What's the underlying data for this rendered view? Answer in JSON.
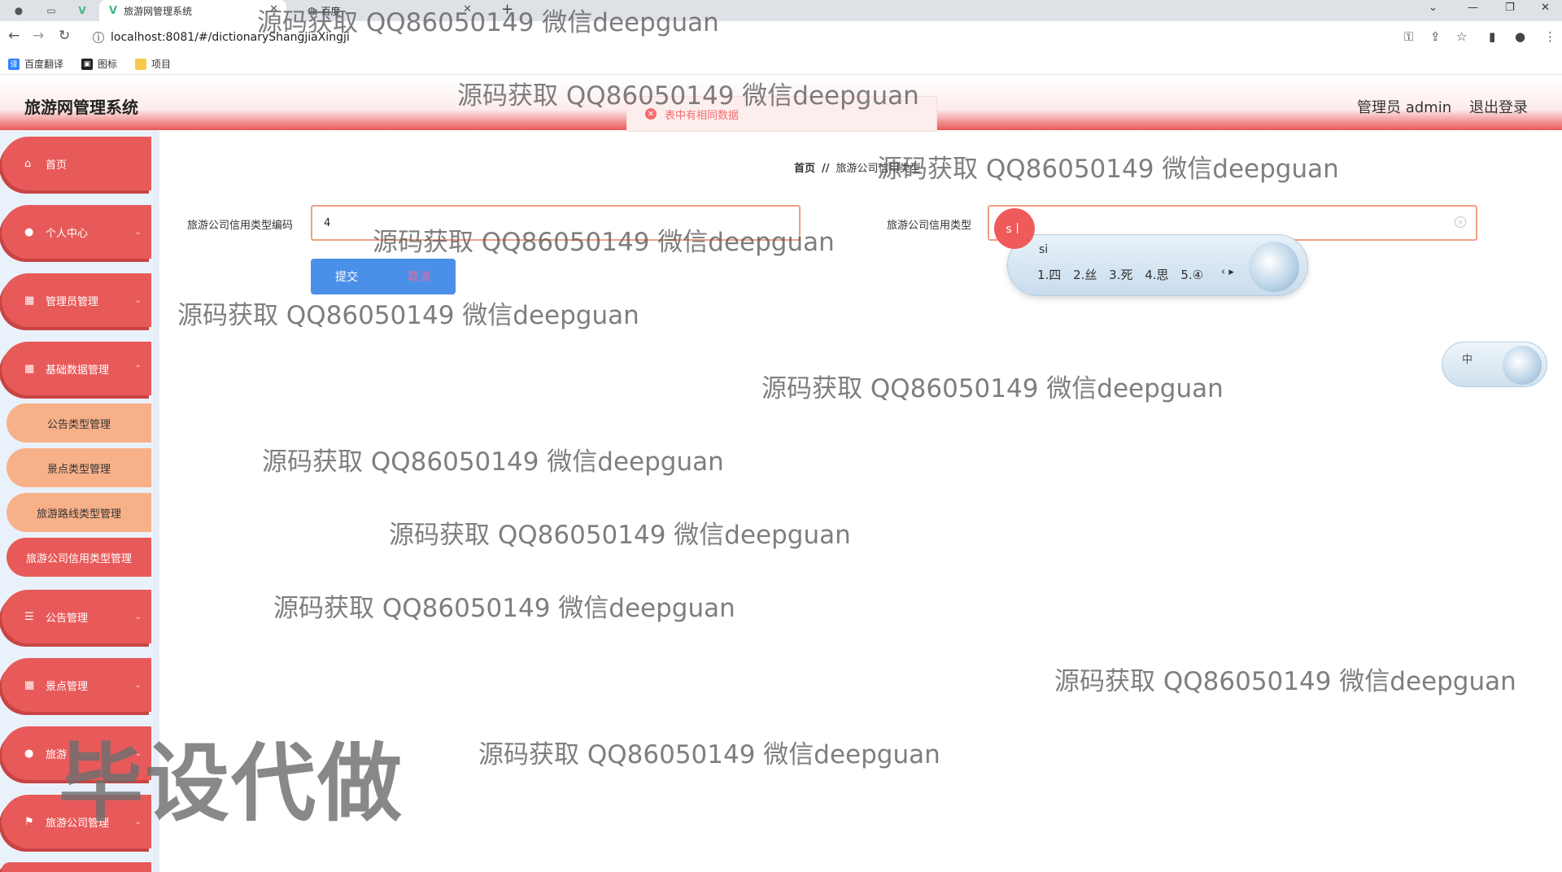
{
  "browser": {
    "active_tab_title": "旅游网管理系统",
    "second_tab_title": "百度",
    "url": "localhost:8081/#/dictionaryShangjiaXingji",
    "bookmarks": [
      {
        "label": "百度翻译",
        "icon": "translate-icon",
        "color": "#3385ff"
      },
      {
        "label": "图标",
        "icon": "image-icon",
        "color": "#222222"
      },
      {
        "label": "项目",
        "icon": "folder-icon",
        "color": "#f7c948"
      }
    ]
  },
  "header": {
    "title": "旅游网管理系统",
    "user": "管理员 admin",
    "logout": "退出登录"
  },
  "toast": {
    "message": "表中有相同数据",
    "type": "error"
  },
  "sidebar": {
    "items": [
      {
        "label": "首页",
        "icon": "home-icon"
      },
      {
        "label": "个人中心",
        "icon": "user-icon"
      },
      {
        "label": "管理员管理",
        "icon": "grid-icon"
      },
      {
        "label": "基础数据管理",
        "icon": "grid-icon"
      },
      {
        "label": "公告管理",
        "icon": "list-icon"
      },
      {
        "label": "景点管理",
        "icon": "grid-icon"
      },
      {
        "label": "旅游",
        "icon": "user-icon"
      },
      {
        "label": "旅游公司管理",
        "icon": "flag-icon"
      }
    ],
    "subitems": [
      {
        "label": "公告类型管理"
      },
      {
        "label": "景点类型管理"
      },
      {
        "label": "旅游路线类型管理"
      },
      {
        "label": "旅游公司信用类型管理",
        "active": true
      }
    ]
  },
  "breadcrumb": {
    "home": "首页",
    "separator": "//",
    "current": "旅游公司信用类型"
  },
  "form": {
    "code_label": "旅游公司信用类型编码",
    "code_value": "4",
    "type_label": "旅游公司信用类型",
    "type_value": "",
    "submit": "提交",
    "cancel": "取消"
  },
  "ime": {
    "badge": "s丨",
    "composition": "si",
    "candidates": "1.四 2.丝 3.死 4.思 5.④",
    "status": "中"
  },
  "watermarks": {
    "text": "源码获取 QQ86050149 微信deepguan",
    "big": "毕设代做"
  },
  "colors": {
    "accent_red": "#e85a5a",
    "sub_orange": "#f8b089",
    "button_blue": "#4a90e8",
    "error": "#f56c6c"
  }
}
